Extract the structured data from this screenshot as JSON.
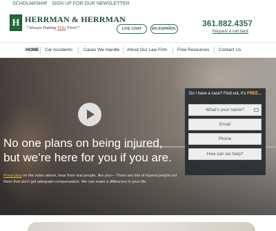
{
  "topbar": {
    "scholarship": "SCHOLARSHIP",
    "separator": "|",
    "newsletter": "SIGN UP FOR OUR NEWSLETTER"
  },
  "logo": {
    "mark": "H",
    "name": "HERRMAN & HERRMAN",
    "tag_before": "“Always Putting ",
    "tag_you": "YOU",
    "tag_after": " First!”"
  },
  "header": {
    "live_chat": "LIVE CHAT",
    "espanol": "EN ESPAÑOL",
    "phone": "361.882.4357",
    "callback": "Request a call back"
  },
  "nav": {
    "items": [
      {
        "label": "HOME"
      },
      {
        "label": "Car Accidents"
      },
      {
        "label": "Cases We Handle"
      },
      {
        "label": "About Our Law Firm"
      },
      {
        "label": "Free Resources"
      },
      {
        "label": "Contact Us"
      }
    ]
  },
  "hero": {
    "headline": "No one plans on being injured, but we’re here for you if you are.",
    "intro_link": "Press play",
    "intro_rest": " on the video above, hear from real people, like you— There are lots of injured people out there that don’t get adequate compensation. We can make a difference in your life."
  },
  "form": {
    "head": "Do I have a case? Find out, it’s ",
    "head_free": "FREE...",
    "name_placeholder": "What’s your name?",
    "email_placeholder": "Email",
    "phone_placeholder": "Phone",
    "help_placeholder": "How can we help?"
  },
  "colors": {
    "brand_green": "#2d6a4f",
    "accent_gold": "#f5c242",
    "logo_green": "#1f6b3b"
  }
}
